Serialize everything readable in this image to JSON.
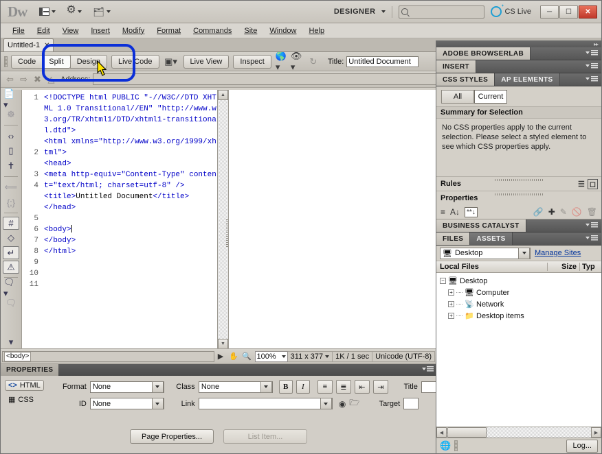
{
  "titlebar": {
    "logo": "Dw",
    "workspace_label": "DESIGNER",
    "search_placeholder": "",
    "search_value": "",
    "cslive_label": "CS Live",
    "minimize": "—",
    "restore": "❐",
    "close": "✕"
  },
  "menubar": {
    "items": [
      "File",
      "Edit",
      "View",
      "Insert",
      "Modify",
      "Format",
      "Commands",
      "Site",
      "Window",
      "Help"
    ]
  },
  "doctab": {
    "name": "Untitled-1",
    "close": "✕",
    "dock_icon": "❐"
  },
  "doctoolbar": {
    "view_buttons": [
      "Code",
      "Split",
      "Design"
    ],
    "active_view": "Split",
    "live_code": "Live Code",
    "live_view": "Live View",
    "inspect": "Inspect",
    "title_label": "Title:",
    "title_value": "Untitled Document"
  },
  "addressbar": {
    "label": "Address:",
    "value": ""
  },
  "code": {
    "lines": [
      {
        "num": "1",
        "text": "<!DOCTYPE html PUBLIC \"-//W3C//DTD XHTML 1.0 Transitional//EN\" \"http://www.w3.org/TR/xhtml1/DTD/xhtml1-transitional.dtd\">"
      },
      {
        "num": "2",
        "text": "<html xmlns=\"http://www.w3.org/1999/xhtml\">"
      },
      {
        "num": "3",
        "text": "<head>"
      },
      {
        "num": "4",
        "text": "<meta http-equiv=\"Content-Type\" content=\"text/html; charset=utf-8\" />"
      },
      {
        "num": "5",
        "text": "<title>Untitled Document</title>"
      },
      {
        "num": "6",
        "text": "</head>"
      },
      {
        "num": "7",
        "text": ""
      },
      {
        "num": "8",
        "text": "<body>"
      },
      {
        "num": "9",
        "text": "</body>"
      },
      {
        "num": "10",
        "text": "</html>"
      },
      {
        "num": "11",
        "text": ""
      }
    ],
    "line_numbers": [
      "1",
      "2",
      "3",
      "4",
      "5",
      "6",
      "7",
      "8",
      "9",
      "10",
      "11"
    ]
  },
  "statusbar": {
    "tag_selector": "<body>",
    "zoom": "100%",
    "dimensions": "311 x 377",
    "weight": "1K / 1 sec",
    "encoding": "Unicode (UTF-8)"
  },
  "properties": {
    "panel_title": "PROPERTIES",
    "html_btn": "HTML",
    "css_btn": "CSS",
    "format_label": "Format",
    "format_value": "None",
    "id_label": "ID",
    "id_value": "None",
    "class_label": "Class",
    "class_value": "None",
    "link_label": "Link",
    "link_value": "",
    "bold": "B",
    "italic": "I",
    "title_label": "Title",
    "title_value": "",
    "target_label": "Target",
    "target_value": "",
    "page_properties": "Page Properties...",
    "list_item": "List Item..."
  },
  "dock": {
    "browserlab": "ADOBE BROWSERLAB",
    "insert": "INSERT",
    "css_tabs": [
      "CSS STYLES",
      "AP ELEMENTS"
    ],
    "css_active_tab": "CSS STYLES",
    "css_mode": [
      "All",
      "Current"
    ],
    "css_mode_active": "Current",
    "summary_header": "Summary for Selection",
    "summary_text": "No CSS properties apply to the current selection.  Please select a styled element to see which CSS properties apply.",
    "rules_label": "Rules",
    "properties_label": "Properties",
    "business_catalyst": "BUSINESS CATALYST",
    "files_tabs": [
      "FILES",
      "ASSETS"
    ],
    "files_active_tab": "FILES",
    "site_selector": "Desktop",
    "manage_sites": "Manage Sites",
    "columns": [
      "Local Files",
      "Size",
      "Typ"
    ],
    "tree": [
      {
        "label": "Desktop",
        "icon": "computer",
        "expanded": true,
        "depth": 0
      },
      {
        "label": "Computer",
        "icon": "computer",
        "expanded": false,
        "depth": 1
      },
      {
        "label": "Network",
        "icon": "network",
        "expanded": false,
        "depth": 1
      },
      {
        "label": "Desktop items",
        "icon": "folder",
        "expanded": false,
        "depth": 1
      }
    ],
    "log_button": "Log..."
  },
  "colors": {
    "chrome": "#d4d0c8",
    "dock_dark": "#56565a",
    "code_blue": "#0000c8",
    "accent_blue": "#1e9fd4",
    "annotation": "#0b2fd8",
    "link": "#00339c"
  }
}
